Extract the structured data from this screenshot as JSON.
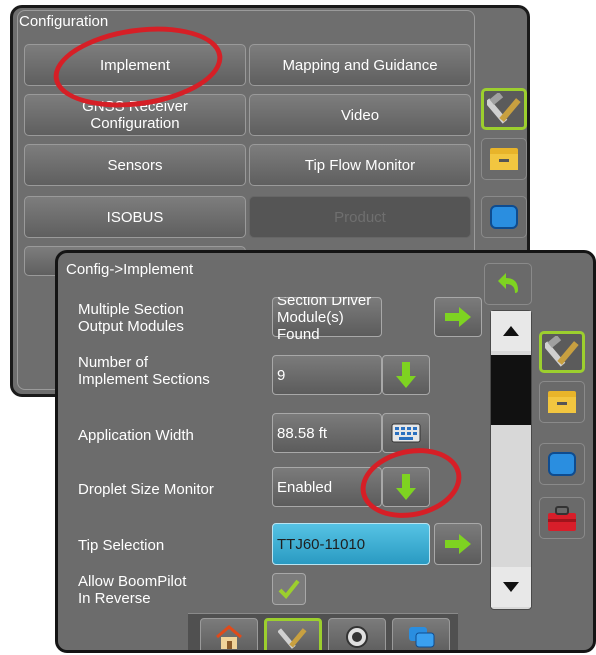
{
  "config_screen": {
    "title": "Configuration",
    "buttons": [
      {
        "label": "Implement"
      },
      {
        "label": "Mapping and Guidance"
      },
      {
        "label": "GNSS Receiver\nConfiguration"
      },
      {
        "label": "Video"
      },
      {
        "label": "Sensors"
      },
      {
        "label": "Tip Flow Monitor"
      },
      {
        "label": "ISOBUS"
      },
      {
        "label": "Product",
        "disabled": true
      }
    ]
  },
  "implement_screen": {
    "title": "Config->Implement",
    "rows": [
      {
        "label": "Multiple Section\nOutput Modules",
        "value": "Section Driver\nModule(s) Found",
        "action": "arrow-right-icon"
      },
      {
        "label": "Number of\nImplement Sections",
        "value": "9",
        "action": "arrow-down-icon"
      },
      {
        "label": "Application Width",
        "value": "88.58 ft",
        "action": "keyboard-icon"
      },
      {
        "label": "Droplet Size Monitor",
        "value": "Enabled",
        "action": "arrow-down-icon"
      },
      {
        "label": "Tip Selection",
        "value": "TTJ60-11010",
        "action": "arrow-right-icon"
      },
      {
        "label": "Allow BoomPilot\nIn Reverse",
        "checked": true
      }
    ]
  },
  "colors": {
    "panel": "#6c6c6c",
    "accent_green": "#9ccf2e",
    "highlight_blue": "#3fb1d8",
    "annotation_red": "#d61f26"
  },
  "side_icons": [
    "tools-icon",
    "folder-icon",
    "screen-icon",
    "toolbox-icon"
  ],
  "bottom_nav": [
    "home-icon",
    "tools-icon",
    "camera-icon",
    "screens-icon"
  ]
}
